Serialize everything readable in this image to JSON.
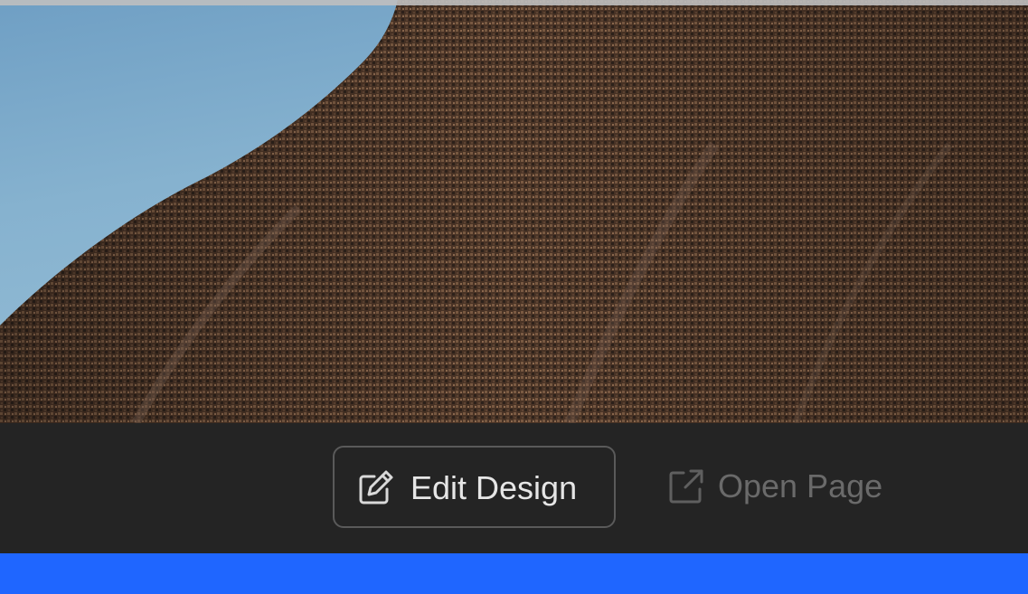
{
  "preview": {
    "image_description_icon": "photo-preview"
  },
  "toolbar": {
    "edit_label": "Edit Design",
    "edit_icon": "edit-icon",
    "open_label": "Open Page",
    "open_icon": "external-link-icon"
  },
  "colors": {
    "toolbar_bg": "#242424",
    "accent_bar": "#1f66ff",
    "edit_text": "#e6e6e6",
    "disabled_text": "#6a6a6a"
  }
}
